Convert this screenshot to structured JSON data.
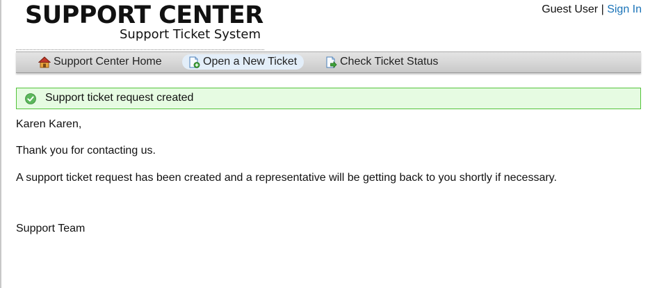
{
  "header": {
    "logo_title": "SUPPORT CENTER",
    "logo_subtitle": "Support Ticket System",
    "user_label": "Guest User",
    "separator": "|",
    "sign_in_label": "Sign In"
  },
  "nav": {
    "items": [
      {
        "label": "Support Center Home",
        "icon": "home-icon",
        "active": false
      },
      {
        "label": "Open a New Ticket",
        "icon": "new-ticket-icon",
        "active": true
      },
      {
        "label": "Check Ticket Status",
        "icon": "ticket-status-icon",
        "active": false
      }
    ]
  },
  "alert": {
    "icon": "check-circle-icon",
    "message": "Support ticket request created"
  },
  "content": {
    "greeting": "Karen Karen,",
    "thanks": "Thank you for contacting us.",
    "body": "A support ticket request has been created and a representative will be getting back to you shortly if necessary.",
    "signature": "Support Team"
  },
  "colors": {
    "link": "#1a73b8",
    "alert_background": "#e6fbe2",
    "alert_border": "#53c33a",
    "active_tab": "#e3eef9"
  }
}
